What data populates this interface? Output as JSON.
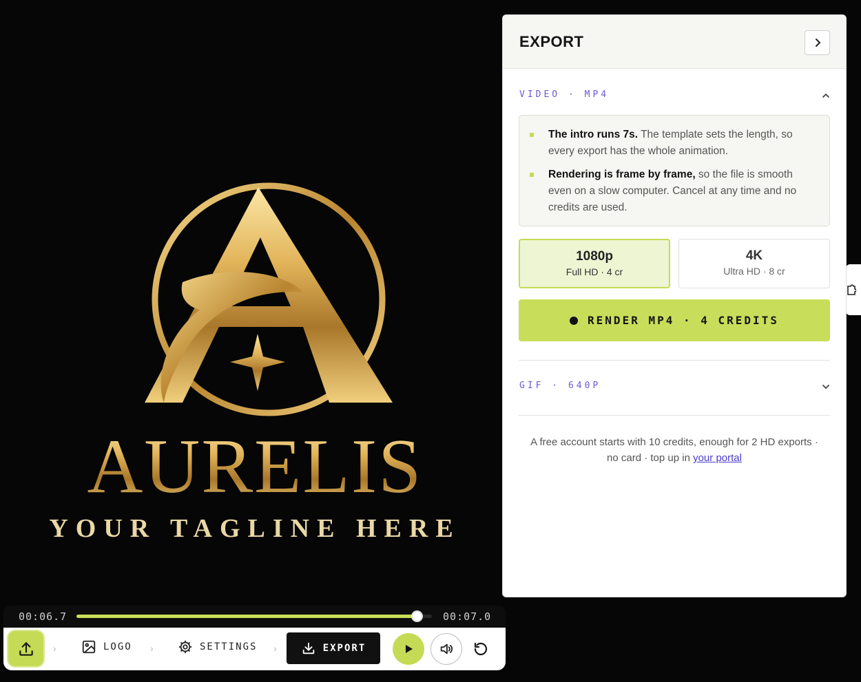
{
  "logo": {
    "brand_name": "AURELIS",
    "tagline": "YOUR TAGLINE HERE",
    "monogram": "A"
  },
  "player": {
    "current_time": "00:06.7",
    "total_time": "00:07.0",
    "progress": 0.957
  },
  "toolbar": {
    "steps": [
      {
        "label": "LOGO",
        "icon": "image-icon"
      },
      {
        "label": "SETTINGS",
        "icon": "gear-icon"
      },
      {
        "label": "EXPORT",
        "icon": "download-icon"
      }
    ]
  },
  "panel": {
    "title": "EXPORT",
    "video_section": {
      "label": "VIDEO · MP4",
      "expanded": true,
      "info": [
        {
          "bold": "The intro runs 7s.",
          "text": " The template sets the length, so every export has the whole animation."
        },
        {
          "bold": "Rendering is frame by frame,",
          "text": " so the file is smooth even on a slow computer. Cancel at any time and no credits are used."
        }
      ],
      "options": [
        {
          "title": "1080p",
          "sub": "Full HD · 4 cr",
          "selected": true
        },
        {
          "title": "4K",
          "sub": "Ultra HD · 8 cr",
          "selected": false
        }
      ],
      "render_label": "RENDER MP4 · 4 CREDITS"
    },
    "gif_section": {
      "label": "GIF · 640P",
      "expanded": false
    },
    "footnote": {
      "line1": "A free account starts with 10 credits, enough for 2 HD exports ·",
      "line2_prefix": "no card · top up in ",
      "link": "your portal"
    }
  },
  "colors": {
    "accent": "#c5db55",
    "link": "#4a3ccc",
    "gold": "#d9ad55"
  }
}
